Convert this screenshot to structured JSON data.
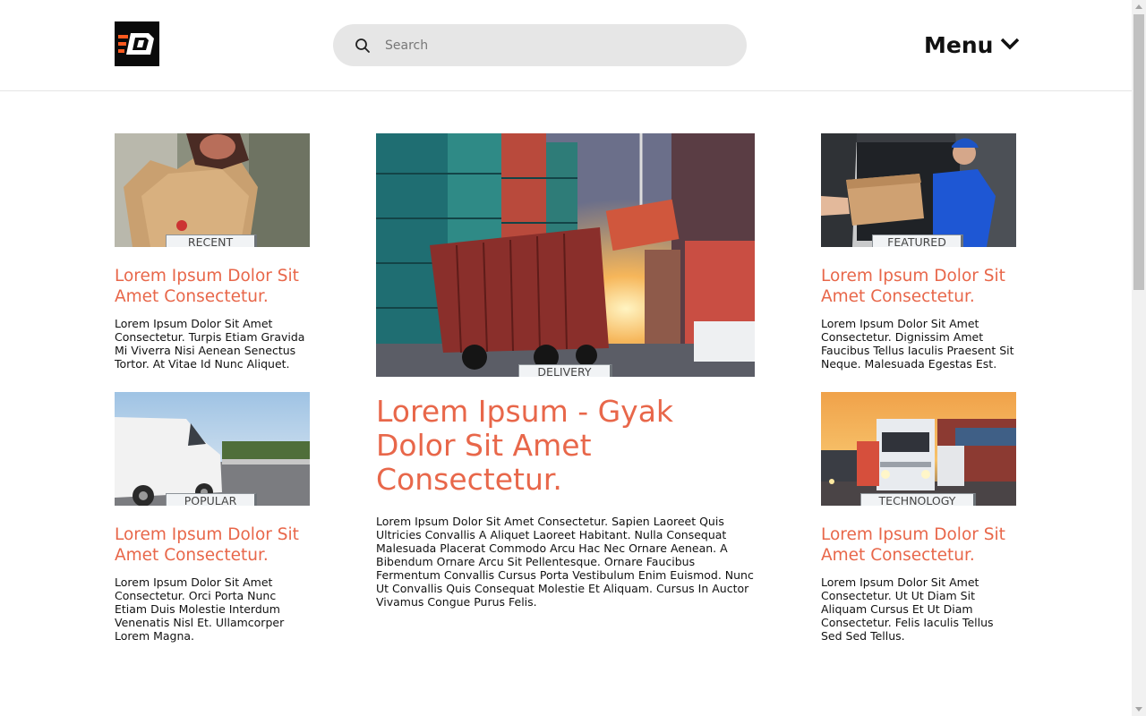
{
  "header": {
    "logo_alt": "logo",
    "search": {
      "placeholder": "Search",
      "value": ""
    },
    "menu_label": "Menu"
  },
  "cards": {
    "recent": {
      "tag": "RECENT",
      "title": "Lorem Ipsum Dolor Sit Amet Consectetur.",
      "text": "Lorem Ipsum Dolor Sit Amet Consectetur. Turpis Etiam Gravida Mi Viverra Nisi Aenean Senectus Tortor. At Vitae Id Nunc Aliquet."
    },
    "popular": {
      "tag": "POPULAR",
      "title": "Lorem Ipsum Dolor Sit Amet Consectetur.",
      "text": "Lorem Ipsum Dolor Sit Amet Consectetur. Orci Porta Nunc Etiam Duis Molestie Interdum Venenatis Nisl Et. Ullamcorper Lorem Magna."
    },
    "delivery": {
      "tag": "DELIVERY",
      "title": "Lorem Ipsum - Gyak Dolor Sit Amet Consectetur.",
      "text": "Lorem Ipsum Dolor Sit Amet Consectetur. Sapien Laoreet Quis Ultricies Convallis A Aliquet Laoreet Habitant. Nulla Consequat Malesuada Placerat Commodo Arcu Hac Nec Ornare Aenean. A Bibendum Ornare Arcu Sit Pellentesque. Ornare Faucibus Fermentum Convallis Cursus Porta Vestibulum Enim Euismod. Nunc Ut Convallis Quis Consequat Molestie Et Aliquam. Cursus In Auctor Vivamus Congue Purus Felis."
    },
    "featured": {
      "tag": "FEATURED",
      "title": "Lorem Ipsum Dolor Sit Amet Consectetur.",
      "text": "Lorem Ipsum Dolor Sit Amet Consectetur. Dignissim Amet Faucibus Tellus Iaculis Praesent Sit Neque. Malesuada Egestas Est."
    },
    "technology": {
      "tag": "TECHNOLOGY",
      "title": "Lorem Ipsum Dolor Sit Amet Consectetur.",
      "text": "Lorem Ipsum Dolor Sit Amet Consectetur. Ut Ut Diam Sit Aliquam Cursus Et Ut Diam Consectetur. Felis Iaculis Tellus Sed Sed Tellus."
    }
  },
  "colors": {
    "accent": "#e8674a",
    "search_bg": "#e6e6e6",
    "logo_bg": "#0a0a0a",
    "logo_mark": "#ff5a1f"
  },
  "icons": {
    "search": "search-icon",
    "menu": "chevron-down-icon",
    "logo": "logo-icon"
  }
}
